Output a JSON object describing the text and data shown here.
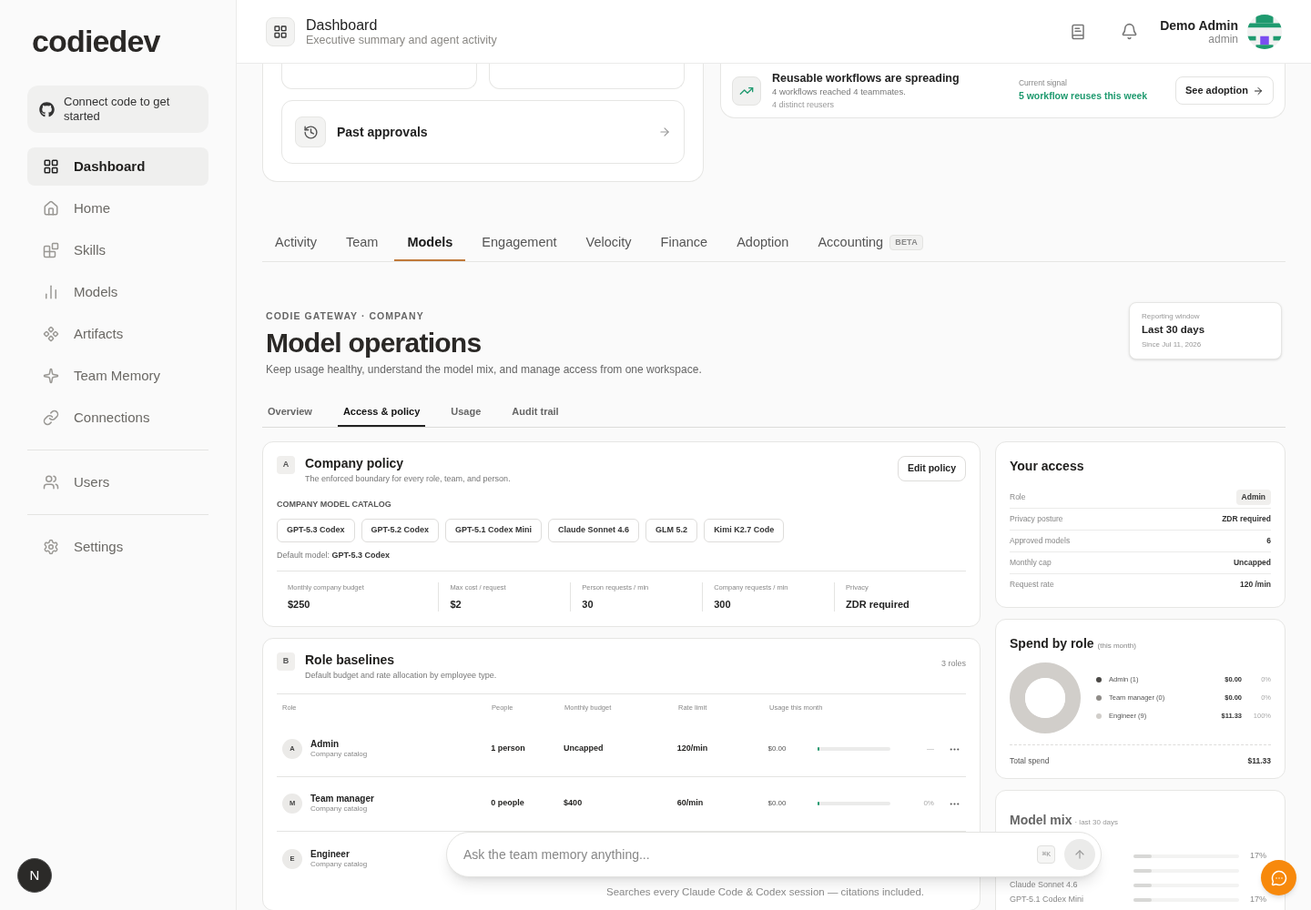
{
  "sidebar": {
    "logo": "codiedev",
    "connect": "Connect code to get started",
    "groups": [
      [
        {
          "label": "Dashboard",
          "selected": true
        },
        {
          "label": "Home",
          "selected": false
        },
        {
          "label": "Skills",
          "selected": false
        },
        {
          "label": "Models",
          "selected": false
        },
        {
          "label": "Artifacts",
          "selected": false
        },
        {
          "label": "Team Memory",
          "selected": false
        },
        {
          "label": "Connections",
          "selected": false
        }
      ],
      [
        {
          "label": "Users",
          "selected": false
        }
      ],
      [
        {
          "label": "Settings",
          "selected": false
        }
      ]
    ],
    "user_badge": "N"
  },
  "header": {
    "title": "Dashboard",
    "subtitle": "Executive summary and agent activity",
    "user_name": "Demo Admin",
    "user_role": "admin"
  },
  "top": {
    "past_approvals": "Past approvals",
    "insight": {
      "title": "Reusable workflows are spreading",
      "detail": "4 workflows reached 4 teammates.",
      "note": "4 distinct reusers",
      "signal_label": "Current signal",
      "signal": "5 workflow reuses this week",
      "action": "See adoption"
    }
  },
  "tabs": [
    {
      "label": "Activity",
      "selected": false
    },
    {
      "label": "Team",
      "selected": false
    },
    {
      "label": "Models",
      "selected": true
    },
    {
      "label": "Engagement",
      "selected": false
    },
    {
      "label": "Velocity",
      "selected": false
    },
    {
      "label": "Finance",
      "selected": false
    },
    {
      "label": "Adoption",
      "selected": false
    },
    {
      "label": "Accounting",
      "selected": false,
      "badge": "BETA"
    }
  ],
  "section": {
    "eyebrow": "CODIE GATEWAY · COMPANY",
    "title": "Model operations",
    "description": "Keep usage healthy, understand the model mix, and manage access from one workspace.",
    "window": {
      "label": "Reporting window",
      "value": "Last 30 days",
      "since": "Since Jul 11, 2026"
    }
  },
  "subtabs": [
    {
      "label": "Overview",
      "selected": false
    },
    {
      "label": "Access & policy",
      "selected": true
    },
    {
      "label": "Usage",
      "selected": false
    },
    {
      "label": "Audit trail",
      "selected": false
    }
  ],
  "policy": {
    "letter": "A",
    "title": "Company policy",
    "subtitle": "The enforced boundary for every role, team, and person.",
    "action": "Edit policy",
    "catalog_label": "COMPANY MODEL CATALOG",
    "models": [
      "GPT-5.3 Codex",
      "GPT-5.2 Codex",
      "GPT-5.1 Codex Mini",
      "Claude Sonnet 4.6",
      "GLM 5.2",
      "Kimi K2.7 Code"
    ],
    "default_label": "Default model:",
    "default_model": "GPT-5.3 Codex",
    "stats": [
      {
        "label": "Monthly company budget",
        "value": "$250"
      },
      {
        "label": "Max cost / request",
        "value": "$2"
      },
      {
        "label": "Person requests / min",
        "value": "30"
      },
      {
        "label": "Company requests / min",
        "value": "300"
      },
      {
        "label": "Privacy",
        "value": "ZDR required"
      }
    ]
  },
  "roles": {
    "letter": "B",
    "title": "Role baselines",
    "subtitle": "Default budget and rate allocation by employee type.",
    "count": "3 roles",
    "columns": [
      "Role",
      "People",
      "Monthly budget",
      "Rate limit",
      "Usage this month"
    ],
    "rows": [
      {
        "initial": "A",
        "name": "Admin",
        "source": "Company catalog",
        "people": "1 person",
        "budget": "Uncapped",
        "rate": "120/min",
        "usage": "$0.00",
        "level": 0,
        "share": "—"
      },
      {
        "initial": "M",
        "name": "Team manager",
        "source": "Company catalog",
        "people": "0 people",
        "budget": "$400",
        "rate": "60/min",
        "usage": "$0.00",
        "level": 0,
        "share": "0%"
      },
      {
        "initial": "E",
        "name": "Engineer",
        "source": "Company catalog"
      }
    ]
  },
  "access": {
    "title": "Your access",
    "rows": [
      {
        "label": "Role",
        "value": "Admin",
        "kind": "tag"
      },
      {
        "label": "Privacy posture",
        "value": "ZDR required",
        "kind": "text"
      },
      {
        "label": "Approved models",
        "value": "6",
        "kind": "text"
      },
      {
        "label": "Monthly cap",
        "value": "Uncapped",
        "kind": "text"
      },
      {
        "label": "Request rate",
        "value": "120 /min",
        "kind": "text"
      }
    ]
  },
  "spend": {
    "title": "Spend by role",
    "qualifier": "(this month)",
    "total_label": "Total spend",
    "total": "$11.33",
    "legend": [
      {
        "amount": "$0.00",
        "pct": "0%",
        "color": "#4a4845"
      },
      {
        "amount": "$0.00",
        "pct": "0%",
        "color": "#8f8c88"
      },
      {
        "amount": "$11.33",
        "pct": "100%",
        "color": "#d1ceca"
      }
    ],
    "chart_data": {
      "type": "donut",
      "categories": [
        "Admin (1)",
        "Team manager (0)",
        "Engineer (9)"
      ],
      "values": [
        0,
        0,
        100
      ]
    }
  },
  "mix": {
    "title": "Model mix",
    "qualifier": "· last 30 days",
    "rows": [
      {
        "pct": "17%",
        "level": 0.17
      },
      {
        "level": 0.17
      },
      {
        "name": "Claude Sonnet 4.6",
        "level": 0.17
      },
      {
        "name": "GPT-5.1 Codex Mini",
        "pct": "17%",
        "level": 0.17
      }
    ]
  },
  "ask": {
    "placeholder": "Ask the team memory anything...",
    "shortcut": "⌘K",
    "caption": "Searches every Claude Code & Codex session — citations included."
  }
}
